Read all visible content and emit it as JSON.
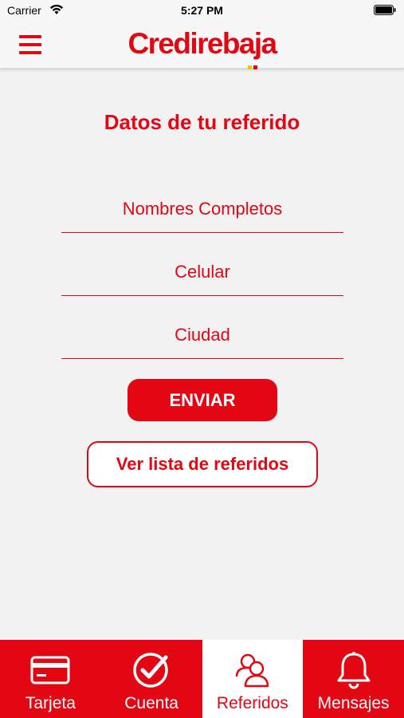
{
  "status_bar": {
    "carrier": "Carrier",
    "time": "5:27 PM"
  },
  "header": {
    "brand": "Credirebaja",
    "menu_icon": "hamburger-menu-icon",
    "brand_color": "#e30613",
    "logo_dot_colors": [
      "#f5c400",
      "#e30613"
    ]
  },
  "form": {
    "title": "Datos de tu referido",
    "fields": {
      "nombres_placeholder": "Nombres Completos",
      "celular_placeholder": "Celular",
      "ciudad_placeholder": "Ciudad"
    },
    "submit_label": "ENVIAR",
    "list_label": "Ver lista de referidos"
  },
  "tab_bar": {
    "active_tab": "Referidos",
    "tabs": [
      {
        "label": "Tarjeta",
        "icon": "credit-card-icon"
      },
      {
        "label": "Cuenta",
        "icon": "check-circle-icon"
      },
      {
        "label": "Referidos",
        "icon": "people-icon"
      },
      {
        "label": "Mensajes",
        "icon": "bell-icon"
      }
    ]
  }
}
